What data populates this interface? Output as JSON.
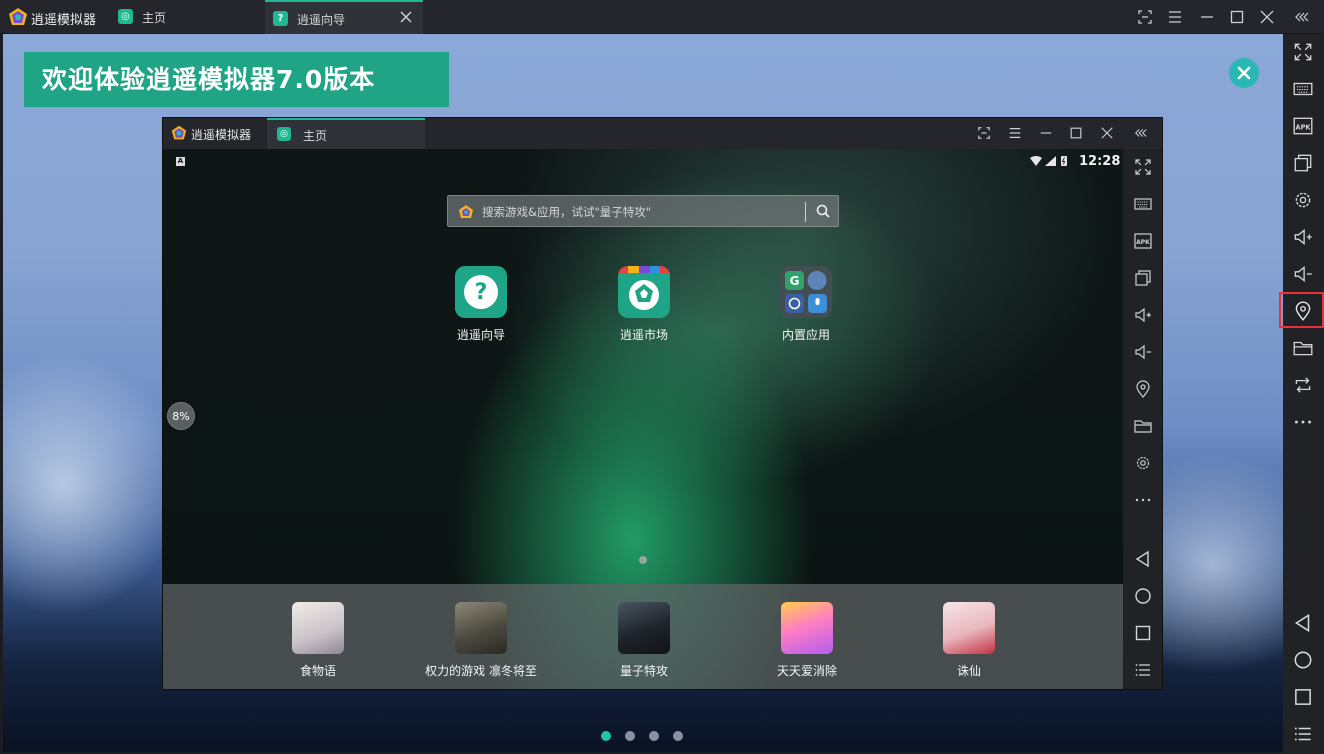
{
  "window": {
    "app_title": "逍遥模拟器",
    "tabs": [
      {
        "label": "主页",
        "active": false
      },
      {
        "label": "逍遥向导",
        "active": true
      }
    ]
  },
  "banner": {
    "text": "欢迎体验逍遥模拟器7.0版本"
  },
  "carousel": {
    "count": 4,
    "active_index": 0
  },
  "inner_window": {
    "app_title": "逍遥模拟器",
    "tab_label": "主页",
    "status": {
      "keyboard_badge": "A",
      "time": "12:28"
    },
    "search": {
      "placeholder": "搜索游戏&应用，试试\"量子特攻\""
    },
    "home_apps": [
      {
        "label": "逍遥向导",
        "icon": "question-icon"
      },
      {
        "label": "逍遥市场",
        "icon": "market-icon"
      },
      {
        "label": "内置应用",
        "icon": "app-folder-icon"
      }
    ],
    "dock_apps": [
      {
        "label": "食物语"
      },
      {
        "label": "权力的游戏 凛冬将至"
      },
      {
        "label": "量子特攻"
      },
      {
        "label": "天天爱消除"
      },
      {
        "label": "诛仙"
      }
    ],
    "progress_bubble": "8%"
  },
  "colors": {
    "accent": "#1fb893",
    "banner": "#1fa486",
    "highlight": "#e8313a"
  },
  "sidebar": {
    "icons": [
      "fullscreen-icon",
      "keyboard-icon",
      "apk-icon",
      "multi-window-icon",
      "settings-icon",
      "volume-up-icon",
      "volume-down-icon",
      "location-icon",
      "folder-icon",
      "sync-icon",
      "more-icon",
      "back-icon",
      "home-icon",
      "recents-icon",
      "menu-icon"
    ],
    "highlighted": "location-icon"
  }
}
